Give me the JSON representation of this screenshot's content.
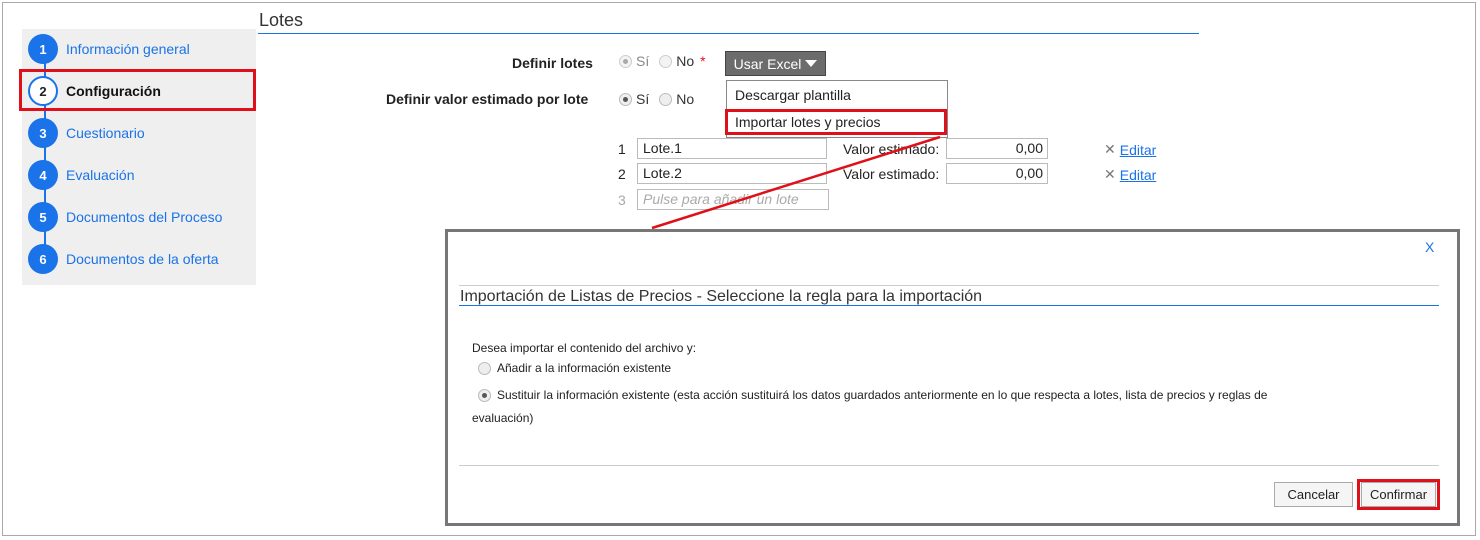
{
  "page": {
    "title": "Lotes"
  },
  "sidebar": {
    "steps": [
      {
        "num": "1",
        "label": "Información general"
      },
      {
        "num": "2",
        "label": "Configuración"
      },
      {
        "num": "3",
        "label": "Cuestionario"
      },
      {
        "num": "4",
        "label": "Evaluación"
      },
      {
        "num": "5",
        "label": "Documentos del Proceso"
      },
      {
        "num": "6",
        "label": "Documentos de la oferta"
      }
    ],
    "active_step": "2"
  },
  "form": {
    "definir_lotes": {
      "label": "Definir lotes",
      "opt_si": "Sí",
      "opt_no": "No",
      "selected": "Sí",
      "required_mark": "*"
    },
    "definir_valor": {
      "label": "Definir valor estimado por lote",
      "opt_si": "Sí",
      "opt_no": "No",
      "selected": "Sí"
    },
    "excel_button": "Usar Excel",
    "excel_menu": [
      "Descargar plantilla",
      "Importar lotes y precios"
    ]
  },
  "lotes": {
    "rows": [
      {
        "num": "1",
        "name": "Lote.1",
        "value_label": "Valor estimado:",
        "value": "0,00",
        "edit": "Editar"
      },
      {
        "num": "2",
        "name": "Lote.2",
        "value_label": "Valor estimado:",
        "value": "0,00",
        "edit": "Editar"
      }
    ],
    "new_row": {
      "num": "3",
      "placeholder": "Pulse para añadir un lote"
    }
  },
  "modal": {
    "close": "X",
    "title": "Importación de Listas de Precios - Seleccione la regla para la importación",
    "question": "Desea importar el contenido del archivo y:",
    "options": [
      "Añadir a la información existente",
      "Sustituir la información existente (esta acción sustituirá los datos guardados anteriormente en lo que respecta a lotes, lista de precios y reglas de"
    ],
    "option_continuation": "evaluación)",
    "selected_option": 1,
    "cancel": "Cancelar",
    "confirm": "Confirmar"
  },
  "colors": {
    "accent": "#1a73e8",
    "highlight": "#e0101a"
  }
}
